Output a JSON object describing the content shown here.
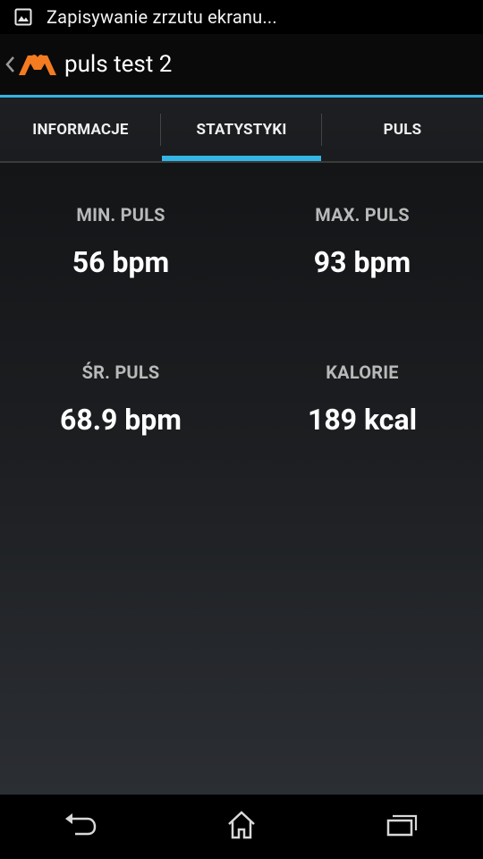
{
  "status_bar": {
    "icon": "image-icon",
    "notification_text": "Zapisywanie zrzutu ekranu..."
  },
  "action_bar": {
    "up_icon": "chevron-left-icon",
    "logo_icon": "heart-logo-icon",
    "title": "puls test 2",
    "accent_color": "#33b5e5",
    "logo_color": "#f47b20"
  },
  "tabs": [
    {
      "label": "INFORMACJE",
      "selected": false
    },
    {
      "label": "STATYSTYKI",
      "selected": true
    },
    {
      "label": "PULS",
      "selected": false
    }
  ],
  "stats": {
    "min_pulse": {
      "label": "MIN. PULS",
      "value": "56 bpm"
    },
    "max_pulse": {
      "label": "MAX. PULS",
      "value": "93 bpm"
    },
    "avg_pulse": {
      "label": "ŚR. PULS",
      "value": "68.9 bpm"
    },
    "calories": {
      "label": "KALORIE",
      "value": "189 kcal"
    }
  },
  "nav_bar": {
    "back_icon": "back-icon",
    "home_icon": "home-icon",
    "recents_icon": "recent-apps-icon"
  }
}
